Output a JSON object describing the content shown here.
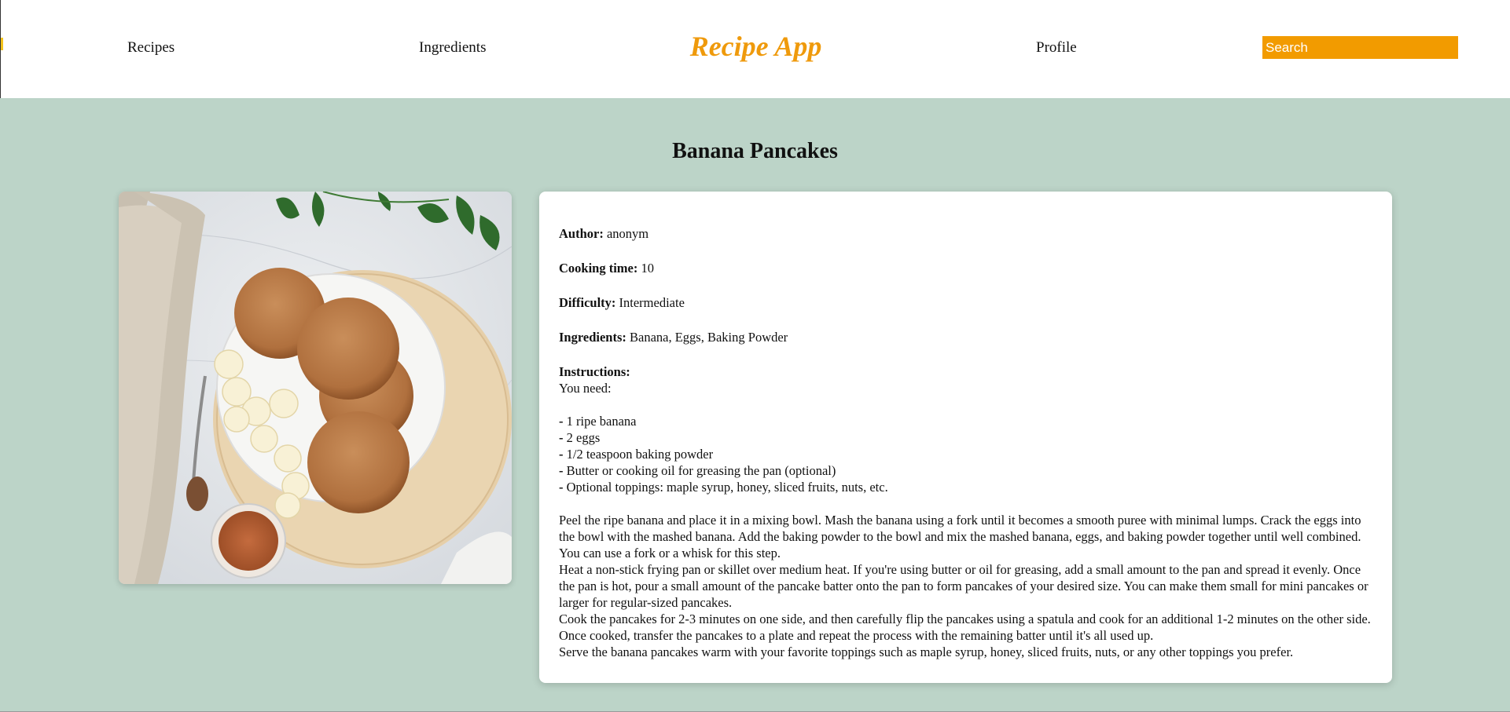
{
  "header": {
    "nav": {
      "recipes": "Recipes",
      "ingredients": "Ingredients",
      "profile": "Profile"
    },
    "logo": "Recipe App",
    "search_placeholder": "Search"
  },
  "recipe": {
    "title": "Banana Pancakes",
    "author_label": "Author:",
    "author": "anonym",
    "cooking_time_label": "Cooking time:",
    "cooking_time": "10",
    "difficulty_label": "Difficulty:",
    "difficulty": "Intermediate",
    "ingredients_label": "Ingredients:",
    "ingredients": "Banana, Eggs, Baking Powder",
    "instructions_label": "Instructions:",
    "you_need": "You need:",
    "list_bullet": "-",
    "list": [
      "1 ripe banana",
      "2 eggs",
      "1/2 teaspoon baking powder",
      "Butter or cooking oil for greasing the pan (optional)",
      "Optional toppings: maple syrup, honey, sliced fruits, nuts, etc."
    ],
    "steps": [
      "Peel the ripe banana and place it in a mixing bowl. Mash the banana using a fork until it becomes a smooth puree with minimal lumps. Crack the eggs into the bowl with the mashed banana. Add the baking powder to the bowl and mix the mashed banana, eggs, and baking powder together until well combined. You can use a fork or a whisk for this step.",
      "Heat a non-stick frying pan or skillet over medium heat. If you're using butter or oil for greasing, add a small amount to the pan and spread it evenly. Once the pan is hot, pour a small amount of the pancake batter onto the pan to form pancakes of your desired size. You can make them small for mini pancakes or larger for regular-sized pancakes.",
      "Cook the pancakes for 2-3 minutes on one side, and then carefully flip the pancakes using a spatula and cook for an additional 1-2 minutes on the other side. Once cooked, transfer the pancakes to a plate and repeat the process with the remaining batter until it's all used up.",
      "Serve the banana pancakes warm with your favorite toppings such as maple syrup, honey, sliced fruits, nuts, or any other toppings you prefer."
    ]
  },
  "colors": {
    "accent": "#ef9a0c",
    "search_bg": "#f29b00",
    "page_bg": "#bcd4c8",
    "card_bg": "#ffffff"
  },
  "icons": {
    "recipe_photo": "pancake-plate-photo"
  }
}
